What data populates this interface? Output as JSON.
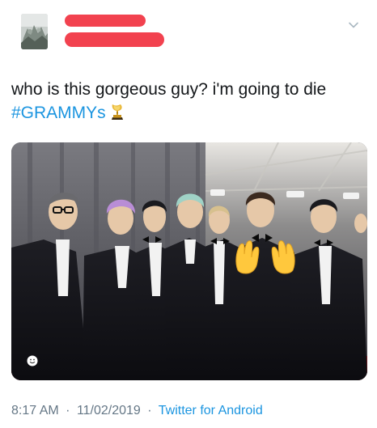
{
  "tweet": {
    "text_line1": "who is this gorgeous guy? i'm going to die",
    "hashtag": "#GRAMMYs",
    "hashtag_emoji": "trophy-gramophone-icon"
  },
  "author": {
    "avatar": "avatar-photo",
    "name_redaction_color": "#f2424f"
  },
  "photo": {
    "emoji_overlay": "open-hands-emoji",
    "badge": "smiley-icon"
  },
  "meta": {
    "time": "8:17 AM",
    "date": "11/02/2019",
    "separator": "·",
    "source": "Twitter for Android"
  },
  "colors": {
    "text": "#14171a",
    "link": "#1b95e0",
    "muted": "#657786"
  }
}
